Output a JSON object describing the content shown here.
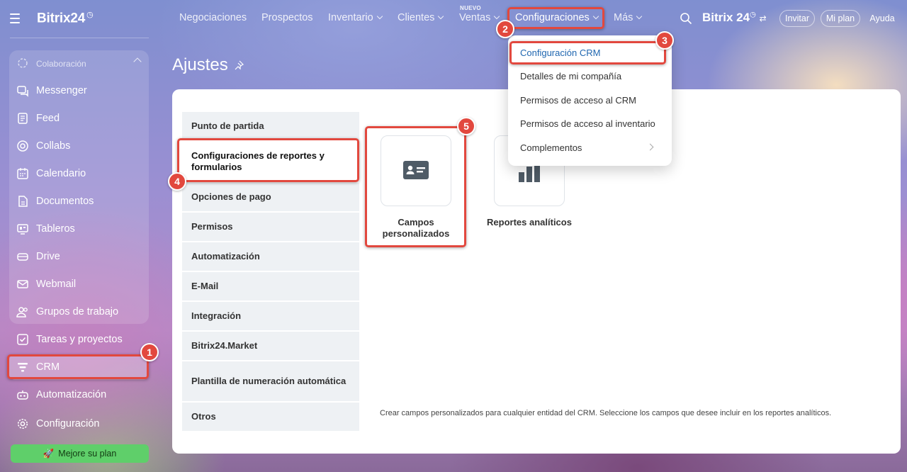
{
  "sidebar": {
    "brand": "Bitrix24",
    "group_title": "Colaboración",
    "items": [
      {
        "label": "Messenger",
        "icon": "chat-icon"
      },
      {
        "label": "Feed",
        "icon": "feed-icon"
      },
      {
        "label": "Collabs",
        "icon": "collabs-icon"
      },
      {
        "label": "Calendario",
        "icon": "calendar-icon"
      },
      {
        "label": "Documentos",
        "icon": "document-icon"
      },
      {
        "label": "Tableros",
        "icon": "board-icon"
      },
      {
        "label": "Drive",
        "icon": "drive-icon"
      },
      {
        "label": "Webmail",
        "icon": "mail-icon"
      },
      {
        "label": "Grupos de trabajo",
        "icon": "group-icon"
      },
      {
        "label": "Tareas y proyectos",
        "icon": "tasks-icon"
      },
      {
        "label": "CRM",
        "icon": "crm-funnel-icon"
      },
      {
        "label": "Automatización",
        "icon": "robot-icon"
      },
      {
        "label": "Configuración",
        "icon": "gear-icon"
      }
    ],
    "upgrade_label": "Mejore su plan"
  },
  "topnav": {
    "items": [
      "Negociaciones",
      "Prospectos",
      "Inventario",
      "Clientes",
      "Ventas",
      "Configuraciones",
      "Más"
    ],
    "badge": "NUEVO",
    "brand": "Bitrix 24",
    "invite": "Invitar",
    "my_plan": "Mi plan",
    "help": "Ayuda"
  },
  "page": {
    "title": "Ajustes"
  },
  "menu": [
    "Punto de partida",
    "Configuraciones de reportes y formularios",
    "Opciones de pago",
    "Permisos",
    "Automatización",
    "E-Mail",
    "Integración",
    "Bitrix24.Market",
    "Plantilla de numeración automática",
    "Otros"
  ],
  "tiles": [
    {
      "label": "Campos personalizados",
      "icon": "id-card-icon"
    },
    {
      "label": "Reportes analíticos",
      "icon": "bar-chart-icon"
    }
  ],
  "description": "Crear campos personalizados para cualquier entidad del CRM. Seleccione los campos que desee incluir en los reportes analíticos.",
  "dropdown": [
    "Configuración CRM",
    "Detalles de mi compañía",
    "Permisos de acceso al CRM",
    "Permisos de acceso al inventario",
    "Complementos"
  ],
  "annotations": [
    "1",
    "2",
    "3",
    "4",
    "5"
  ],
  "colors": {
    "annotation": "#e2483e",
    "upgrade": "#5fcf6a",
    "link": "#2067b0"
  }
}
